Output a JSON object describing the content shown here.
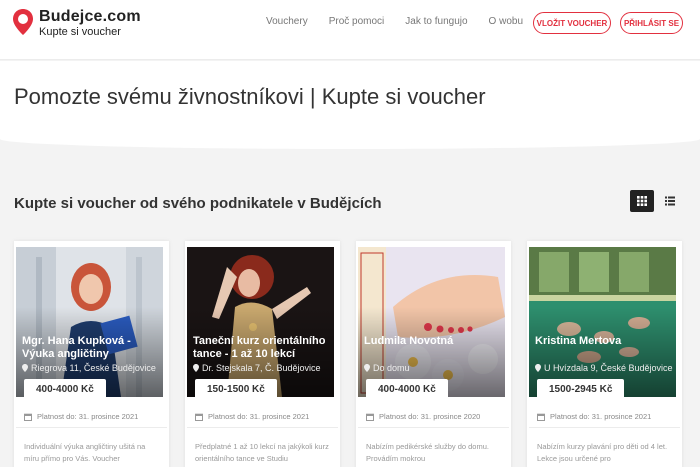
{
  "header": {
    "brand": "Budejce.com",
    "tagline": "Kupte si voucher",
    "nav": [
      "Vouchery",
      "Proč pomoci",
      "Jak to fungujo",
      "O wobu"
    ],
    "insert_voucher_label": "VLOŽIT VOUCHER",
    "login_label": "PŘIHLÁSIT SE"
  },
  "hero": {
    "title": "Pomozte svému živnostníkovi | Kupte si voucher"
  },
  "listing": {
    "title": "Kupte si voucher od svého podnikatele v Budějcích",
    "view_grid_icon": "grid-icon",
    "view_list_icon": "list-icon"
  },
  "cards": [
    {
      "title": "Mgr. Hana Kupková - Výuka angličtiny",
      "location": "Riegrova 11, České Budějovice",
      "price": "400-4000 Kč",
      "validity": "Platnost do: 31. prosince 2021",
      "description": "Individuální výuka angličtiny ušitá na míru přímo pro Vás. Voucher"
    },
    {
      "title": "Taneční kurz orientálního tance - 1 až 10 lekcí",
      "location": "Dr. Stejskala 7, Č. Budějovice",
      "price": "150-1500 Kč",
      "validity": "Platnost do: 31. prosince 2021",
      "description": "Předplatné 1 až 10 lekcí na jakýkoli kurz orientálního tance ve Studiu"
    },
    {
      "title": "Ludmila Novotná",
      "location": "Do domu",
      "price": "400-4000 Kč",
      "validity": "Platnost do: 31. prosince 2020",
      "description": "Nabízím pedikérské služby do domu. Provádím mokrou"
    },
    {
      "title": "Kristina Mertova",
      "location": "U Hvízdala 9, České Budějovice",
      "price": "1500-2945 Kč",
      "validity": "Platnost do: 31. prosince 2021",
      "description": "Nabízím kurzy plavání pro děti od 4 let. Lekce jsou určené pro"
    }
  ],
  "colors": {
    "accent": "#e2303f",
    "dark": "#222222"
  }
}
